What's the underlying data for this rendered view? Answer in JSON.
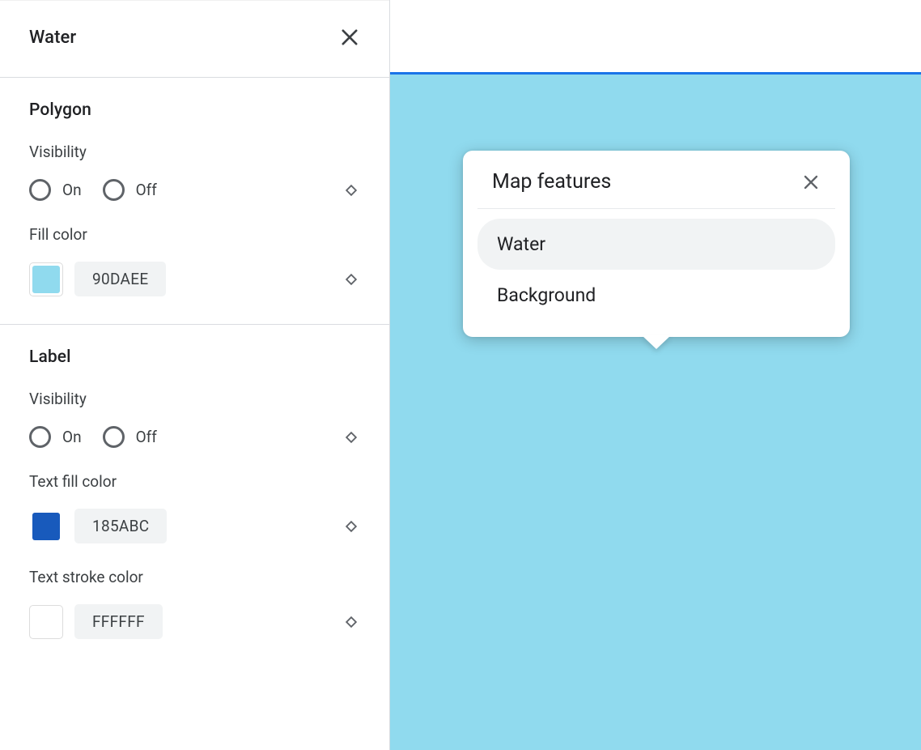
{
  "panel": {
    "title": "Water",
    "sections": {
      "polygon": {
        "title": "Polygon",
        "visibility_label": "Visibility",
        "on_label": "On",
        "off_label": "Off",
        "fill_color_label": "Fill color",
        "fill_color_hex": "90DAEE",
        "fill_color_value": "#90DAEE"
      },
      "label": {
        "title": "Label",
        "visibility_label": "Visibility",
        "on_label": "On",
        "off_label": "Off",
        "text_fill_label": "Text fill color",
        "text_fill_hex": "185ABC",
        "text_fill_value": "#185ABC",
        "text_stroke_label": "Text stroke color",
        "text_stroke_hex": "FFFFFF",
        "text_stroke_value": "#FFFFFF"
      }
    }
  },
  "preview": {
    "water_color": "#90DAEE",
    "accent_color": "#1a73e8"
  },
  "popup": {
    "title": "Map features",
    "items": [
      {
        "label": "Water",
        "selected": true
      },
      {
        "label": "Background",
        "selected": false
      }
    ]
  }
}
